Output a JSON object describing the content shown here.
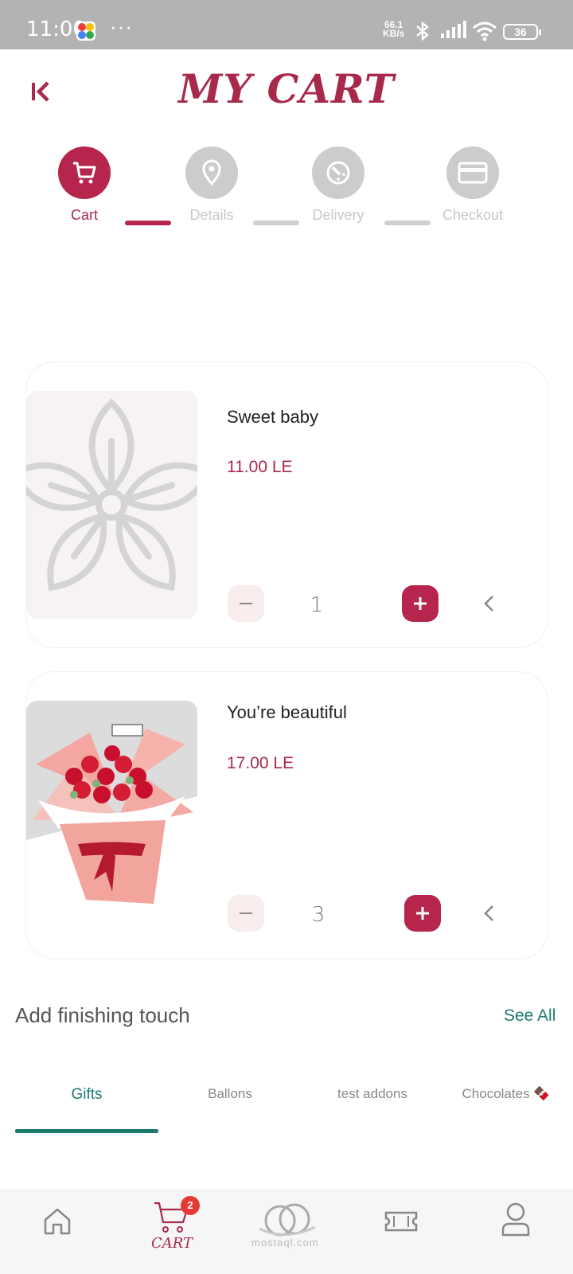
{
  "status_bar": {
    "time": "11:00",
    "dots": "···",
    "speed_value": "66.1",
    "speed_unit": "KB/s",
    "battery": "36"
  },
  "header": {
    "title": "MY CART",
    "back_icon": "first-page-icon"
  },
  "steps": [
    {
      "label": "Cart",
      "icon": "cart-icon",
      "active": true
    },
    {
      "label": "Details",
      "icon": "location-pin-icon",
      "active": false
    },
    {
      "label": "Delivery",
      "icon": "timer-icon",
      "active": false
    },
    {
      "label": "Checkout",
      "icon": "credit-card-icon",
      "active": false
    }
  ],
  "cart_items": [
    {
      "name": "Sweet baby",
      "price": "11.00 LE",
      "quantity": "1",
      "image": "flower-placeholder-icon"
    },
    {
      "name": "You’re beautiful",
      "price": "17.00 LE",
      "quantity": "3",
      "image": "rose-bouquet-image"
    }
  ],
  "finishing_touch": {
    "title": "Add finishing touch",
    "see_all": "See All",
    "tabs": [
      "Gifts",
      "Ballons",
      "test addons",
      "Chocolates 🍫"
    ],
    "active_tab": "Gifts"
  },
  "bottom_nav": {
    "items": [
      "home-icon",
      "cart-icon",
      "logo-icon",
      "ticket-icon",
      "profile-icon"
    ],
    "cart_label": "CART",
    "cart_badge": "2",
    "watermark": "mostaql.com"
  },
  "colors": {
    "brand": "#b6264c",
    "accent_teal": "#1b7a70",
    "status_bar": "#b3b3b3"
  }
}
